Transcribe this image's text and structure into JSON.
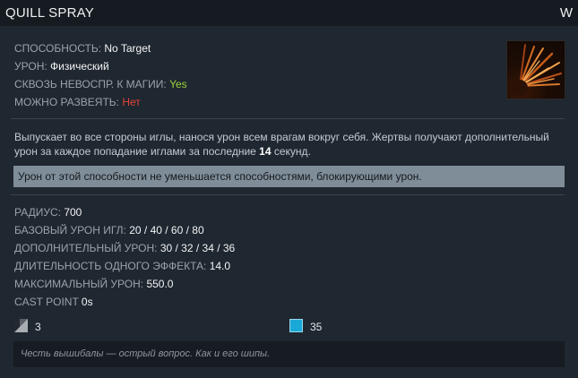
{
  "ability": {
    "name": "QUILL SPRAY",
    "hotkey": "W",
    "icon": "quill-spray-ability-icon"
  },
  "properties": [
    {
      "label": "СПОСОБНОСТЬ:",
      "value": "No Target"
    },
    {
      "label": "УРОН:",
      "value": "Физический"
    },
    {
      "label": "СКВОЗЬ НЕВОСПР. К МАГИИ:",
      "value": "Yes"
    },
    {
      "label": "МОЖНО РАЗВЕЯТЬ:",
      "value": "Нет"
    }
  ],
  "description": {
    "before": "Выпускает во все стороны иглы, нанося урон всем врагам вокруг себя. Жертвы получают дополнительный урон за каждое попадание иглами за последние",
    "highlight": "14",
    "after": "секунд."
  },
  "note": "Урон от этой способности не уменьшается способностями, блокирующими урон.",
  "stats": [
    {
      "label": "РАДИУС:",
      "value": "700"
    },
    {
      "label": "БАЗОВЫЙ УРОН ИГЛ:",
      "value": "20 / 40 / 60 / 80"
    },
    {
      "label": "ДОПОЛНИТЕЛЬНЫЙ УРОН:",
      "value": "30 / 32 / 34 / 36"
    },
    {
      "label": "ДЛИТЕЛЬНОСТЬ ОДНОГО ЭФФЕКТА:",
      "value": "14.0"
    },
    {
      "label": "МАКСИМАЛЬНЫЙ УРОН:",
      "value": "550.0"
    },
    {
      "label": "CAST POINT",
      "value": "0s"
    }
  ],
  "cooldown": {
    "icon": "cooldown-icon",
    "value": "3"
  },
  "mana": {
    "icon": "mana-cost-icon",
    "value": "35"
  },
  "lore": "Честь вышибалы — острый вопрос. Как и его шипы.",
  "colors": {
    "background": "#1f2730",
    "titlebar": "#151b21",
    "yes": "#9bd23c",
    "no": "#e2443a",
    "note_bg": "#7f8d98",
    "mana": "#1aa9d6"
  }
}
